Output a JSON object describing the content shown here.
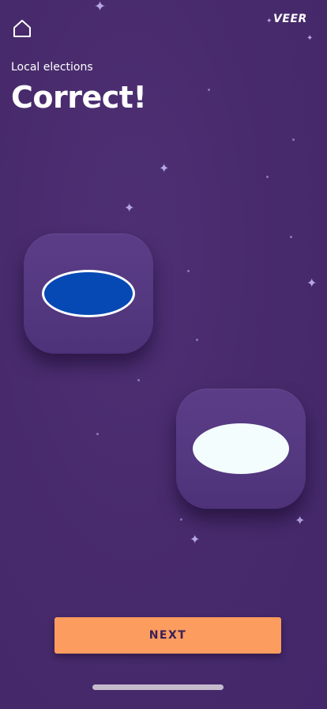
{
  "header": {
    "home_icon": "home-icon",
    "logo_text": "VEER"
  },
  "question": {
    "category": "Local elections",
    "result": "Correct!"
  },
  "tokens": [
    {
      "shape": "oval",
      "fill": "#0749b4",
      "outline": "#ffffff",
      "selected": true
    },
    {
      "shape": "oval",
      "fill": "#f3fdfd",
      "selected": false
    }
  ],
  "actions": {
    "next_label": "NEXT"
  },
  "colors": {
    "background": "#472a6b",
    "card": "#553982",
    "accent_button": "#fc9c5f",
    "button_text": "#3a1f55",
    "star": "#b7a6e4"
  }
}
